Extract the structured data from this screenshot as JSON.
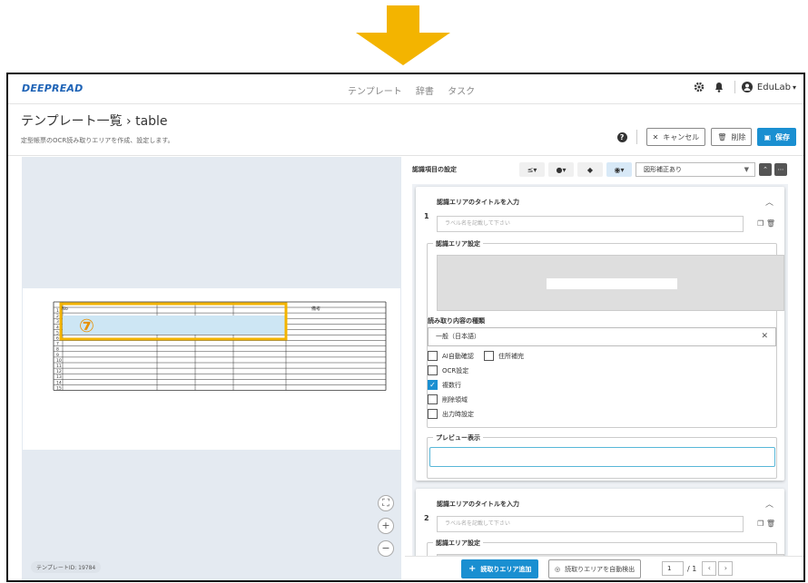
{
  "app": {
    "logo": "DEEPREAD"
  },
  "nav": {
    "items": [
      "テンプレート",
      "辞書",
      "タスク"
    ]
  },
  "user": {
    "name": "EduLab"
  },
  "page": {
    "title": "テンプレート一覧 › table",
    "subtitle": "定型帳票のOCR読み取りエリアを作成、設定します。"
  },
  "actions": {
    "help": "?",
    "cancel": "キャンセル",
    "delete": "削除",
    "save": "保存"
  },
  "canvas": {
    "template_id": "テンプレートID: 19784",
    "marker": "⑦",
    "table_header_no": "No",
    "table_header_note": "備考",
    "row_numbers": [
      "1",
      "2",
      "3",
      "4",
      "5",
      "6",
      "7",
      "8",
      "9",
      "10",
      "11",
      "12",
      "13",
      "14",
      "15"
    ],
    "highlight_color": "#f3b400",
    "selection_fill": "#cde6f4"
  },
  "panel": {
    "header": "認識項目の設定",
    "tools": [
      "≤",
      "●",
      "◆",
      "◉"
    ],
    "correction_select": "図形補正あり"
  },
  "cards": [
    {
      "number": "1",
      "title": "認識エリアのタイトルを入力",
      "label_placeholder": "ラベル名を記載して下さい",
      "area_settings": "認識エリア設定",
      "read_type_label": "読み取り内容の種類",
      "read_type_value": "一般（日本語）",
      "checks": [
        {
          "label": "AI自動確認",
          "checked": false
        },
        {
          "label": "住所補完",
          "checked": false
        },
        {
          "label": "OCR設定",
          "checked": false
        },
        {
          "label": "複数行",
          "checked": true
        },
        {
          "label": "削除領域",
          "checked": false
        },
        {
          "label": "出力時設定",
          "checked": false
        }
      ],
      "preview_label": "プレビュー表示"
    },
    {
      "number": "2",
      "title": "認識エリアのタイトルを入力",
      "label_placeholder": "ラベル名を記載して下さい",
      "area_settings": "認識エリア設定"
    }
  ],
  "bottom": {
    "add": "読取りエリア追加",
    "auto_detect": "読取りエリアを自動検出",
    "page_current": "1",
    "page_total": "/ 1"
  },
  "colors": {
    "accent": "#1a8fd1",
    "logo": "#1e63b6",
    "arrow": "#f3b400"
  }
}
